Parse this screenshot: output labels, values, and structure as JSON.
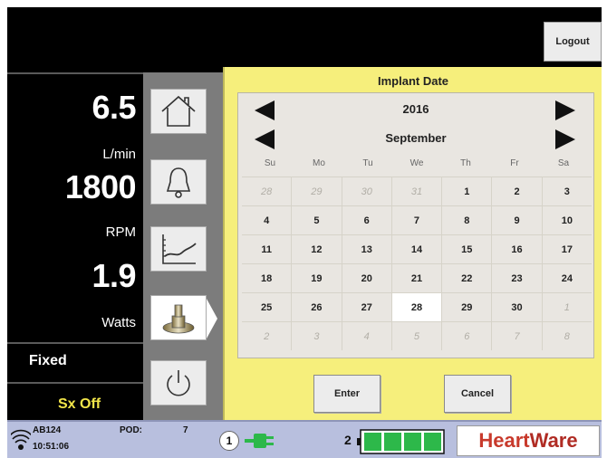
{
  "top": {
    "logout_label": "Logout"
  },
  "metrics": {
    "flow_value": "6.5",
    "flow_unit": "L/min",
    "speed_value": "1800",
    "speed_unit": "RPM",
    "power_value": "1.9",
    "power_unit": "Watts",
    "mode": "Fixed",
    "alarm_status": "Sx Off"
  },
  "nav": {
    "items": [
      {
        "icon": "home-icon"
      },
      {
        "icon": "bell-icon"
      },
      {
        "icon": "trend-chart-icon"
      },
      {
        "icon": "pump-icon",
        "active": true
      },
      {
        "icon": "power-icon"
      }
    ]
  },
  "date_panel": {
    "title": "Implant Date",
    "year": "2016",
    "month": "September",
    "weekdays": [
      "Su",
      "Mo",
      "Tu",
      "We",
      "Th",
      "Fr",
      "Sa"
    ],
    "weeks": [
      [
        {
          "d": "28",
          "other": true
        },
        {
          "d": "29",
          "other": true
        },
        {
          "d": "30",
          "other": true
        },
        {
          "d": "31",
          "other": true
        },
        {
          "d": "1"
        },
        {
          "d": "2"
        },
        {
          "d": "3"
        }
      ],
      [
        {
          "d": "4"
        },
        {
          "d": "5"
        },
        {
          "d": "6"
        },
        {
          "d": "7"
        },
        {
          "d": "8"
        },
        {
          "d": "9"
        },
        {
          "d": "10"
        }
      ],
      [
        {
          "d": "11"
        },
        {
          "d": "12"
        },
        {
          "d": "13"
        },
        {
          "d": "14"
        },
        {
          "d": "15"
        },
        {
          "d": "16"
        },
        {
          "d": "17"
        }
      ],
      [
        {
          "d": "18"
        },
        {
          "d": "19"
        },
        {
          "d": "20"
        },
        {
          "d": "21"
        },
        {
          "d": "22"
        },
        {
          "d": "23"
        },
        {
          "d": "24"
        }
      ],
      [
        {
          "d": "25"
        },
        {
          "d": "26"
        },
        {
          "d": "27"
        },
        {
          "d": "28",
          "selected": true
        },
        {
          "d": "29"
        },
        {
          "d": "30"
        },
        {
          "d": "1",
          "other": true
        }
      ],
      [
        {
          "d": "2",
          "other": true
        },
        {
          "d": "3",
          "other": true
        },
        {
          "d": "4",
          "other": true
        },
        {
          "d": "5",
          "other": true
        },
        {
          "d": "6",
          "other": true
        },
        {
          "d": "7",
          "other": true
        },
        {
          "d": "8",
          "other": true
        }
      ]
    ],
    "enter_label": "Enter",
    "cancel_label": "Cancel"
  },
  "status_bar": {
    "device_id": "AB124",
    "time": "10:51:06",
    "pod_label": "POD:",
    "pod_value": "7",
    "source1_label": "1",
    "source2_label": "2",
    "battery_level": 1.0,
    "brand_part1": "Heart",
    "brand_part2": "Ware"
  },
  "colors": {
    "panel_bg": "#f6ef7c",
    "alarm_text": "#f2e64a",
    "status_bar_bg": "#b8bfde",
    "battery_green": "#2db84a",
    "brand_red": "#c83a2c"
  }
}
